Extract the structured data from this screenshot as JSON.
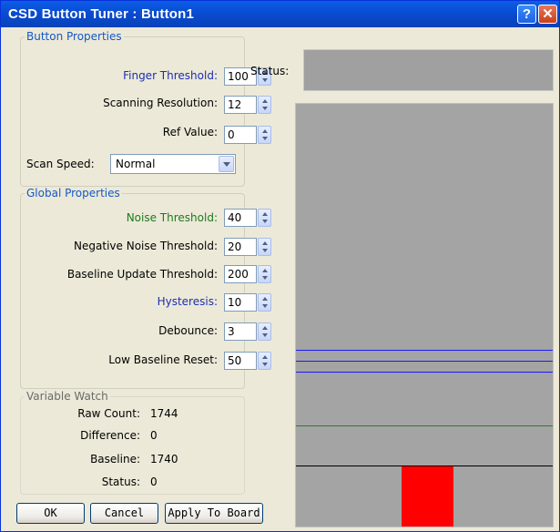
{
  "window": {
    "title": "CSD Button Tuner : Button1",
    "help_glyph": "?",
    "close_glyph": "✕"
  },
  "button_properties": {
    "legend": "Button Properties",
    "finger_threshold": {
      "label": "Finger Threshold:",
      "value": "100"
    },
    "scanning_resolution": {
      "label": "Scanning Resolution:",
      "value": "12"
    },
    "ref_value": {
      "label": "Ref Value:",
      "value": "0"
    },
    "scan_speed": {
      "label": "Scan Speed:",
      "value": "Normal"
    }
  },
  "global_properties": {
    "legend": "Global Properties",
    "noise_threshold": {
      "label": "Noise Threshold:",
      "value": "40"
    },
    "negative_noise_threshold": {
      "label": "Negative Noise Threshold:",
      "value": "20"
    },
    "baseline_update_threshold": {
      "label": "Baseline Update Threshold:",
      "value": "200"
    },
    "hysteresis": {
      "label": "Hysteresis:",
      "value": "10"
    },
    "debounce": {
      "label": "Debounce:",
      "value": "3"
    },
    "low_baseline_reset": {
      "label": "Low Baseline Reset:",
      "value": "50"
    }
  },
  "variable_watch": {
    "legend": "Variable Watch",
    "raw_count": {
      "label": "Raw Count:",
      "value": "1744"
    },
    "difference": {
      "label": "Difference:",
      "value": "0"
    },
    "baseline": {
      "label": "Baseline:",
      "value": "1740"
    },
    "status": {
      "label": "Status:",
      "value": "0"
    }
  },
  "buttons": {
    "ok": "OK",
    "cancel": "Cancel",
    "apply": "Apply To Board"
  },
  "status_panel": {
    "label": "Status:"
  },
  "colors": {
    "threshold_line": "#1a1aff",
    "noise_line": "#2e7d2e",
    "baseline_line": "#000000",
    "signal_bar": "#ff0000",
    "graph_bg": "#a4a4a4"
  }
}
